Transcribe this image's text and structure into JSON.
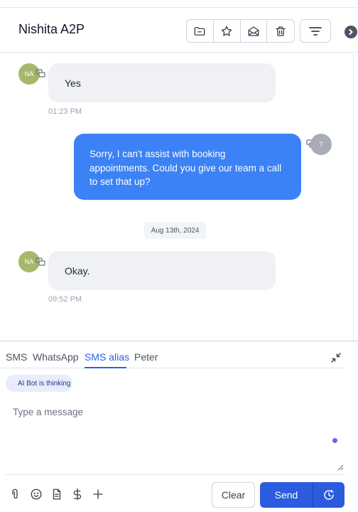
{
  "header": {
    "contact_name": "Nishita A2P",
    "actions": [
      "folder-minus-icon",
      "star-icon",
      "envelope-open-icon",
      "trash-icon"
    ],
    "filter_icon": "filter-lines-icon"
  },
  "thread": {
    "messages": [
      {
        "direction": "inbound",
        "avatar": "NA",
        "text": "Yes",
        "time": "01:23 PM"
      },
      {
        "direction": "outbound",
        "avatar": "?",
        "text": "Sorry, I can't assist with booking appointments. Could you give our team a call to set that up?"
      },
      {
        "direction": "inbound",
        "avatar": "NA",
        "text": "Okay.",
        "time": "09:52 PM"
      }
    ],
    "date_divider": "Aug 13th, 2024"
  },
  "composer": {
    "tabs": [
      "SMS",
      "WhatsApp",
      "SMS alias",
      "Peter"
    ],
    "active_tab": "SMS alias",
    "ai_status": "AI Bot is thinking",
    "placeholder": "Type a message",
    "toolbar_icons": [
      "paperclip-icon",
      "emoji-icon",
      "document-icon",
      "dollar-icon",
      "plus-icon"
    ],
    "clear_label": "Clear",
    "send_label": "Send"
  },
  "colors": {
    "accent": "#2b5bde",
    "outbound_bubble": "#3b82f6",
    "inbound_bubble": "#f0f1f5",
    "avatar_na": "#a6b96b",
    "ai_indicator": "#7c5ce6"
  }
}
